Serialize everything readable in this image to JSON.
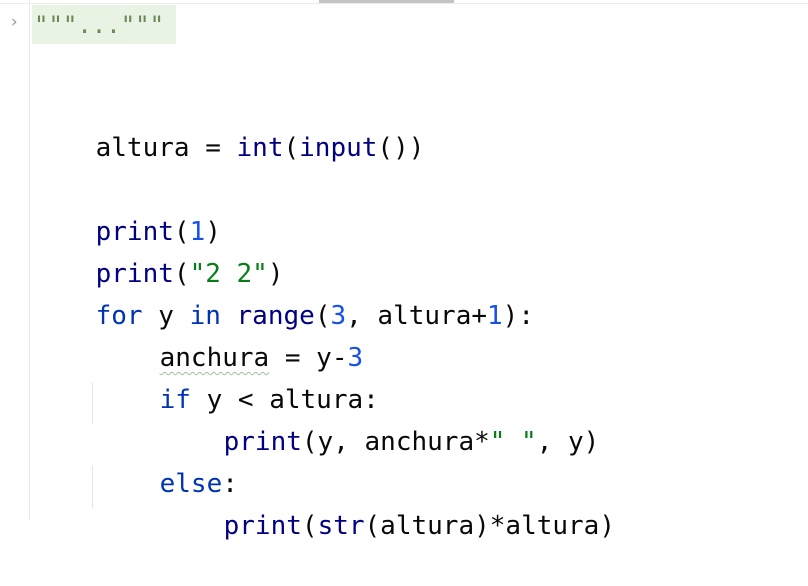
{
  "editor": {
    "folded_docstring": "\"\"\"...\"\"\"",
    "lines": {
      "l1": {
        "var": "altura",
        "op": " = ",
        "fn1": "int",
        "p1": "(",
        "fn2": "input",
        "p2": "())"
      },
      "l2": {
        "fn": "print",
        "p1": "(",
        "num": "1",
        "p2": ")"
      },
      "l3": {
        "fn": "print",
        "p1": "(",
        "str": "\"2 2\"",
        "p2": ")"
      },
      "l4": {
        "kw1": "for",
        "t1": " y ",
        "kw2": "in",
        "t2": " ",
        "fn": "range",
        "p1": "(",
        "num1": "3",
        "t3": ", altura+",
        "num2": "1",
        "p2": "):"
      },
      "l5": {
        "var": "anchura",
        "t1": " = y-",
        "num": "3"
      },
      "l6": {
        "kw": "if",
        "t1": " y < altura:"
      },
      "l7": {
        "fn": "print",
        "t1": "(y, anchura*",
        "str": "\" \"",
        "t2": ", y)"
      },
      "l8": {
        "kw": "else",
        "t1": ":"
      },
      "l9": {
        "fn1": "print",
        "p1": "(",
        "fn2": "str",
        "t1": "(altura)*altura)"
      }
    }
  }
}
